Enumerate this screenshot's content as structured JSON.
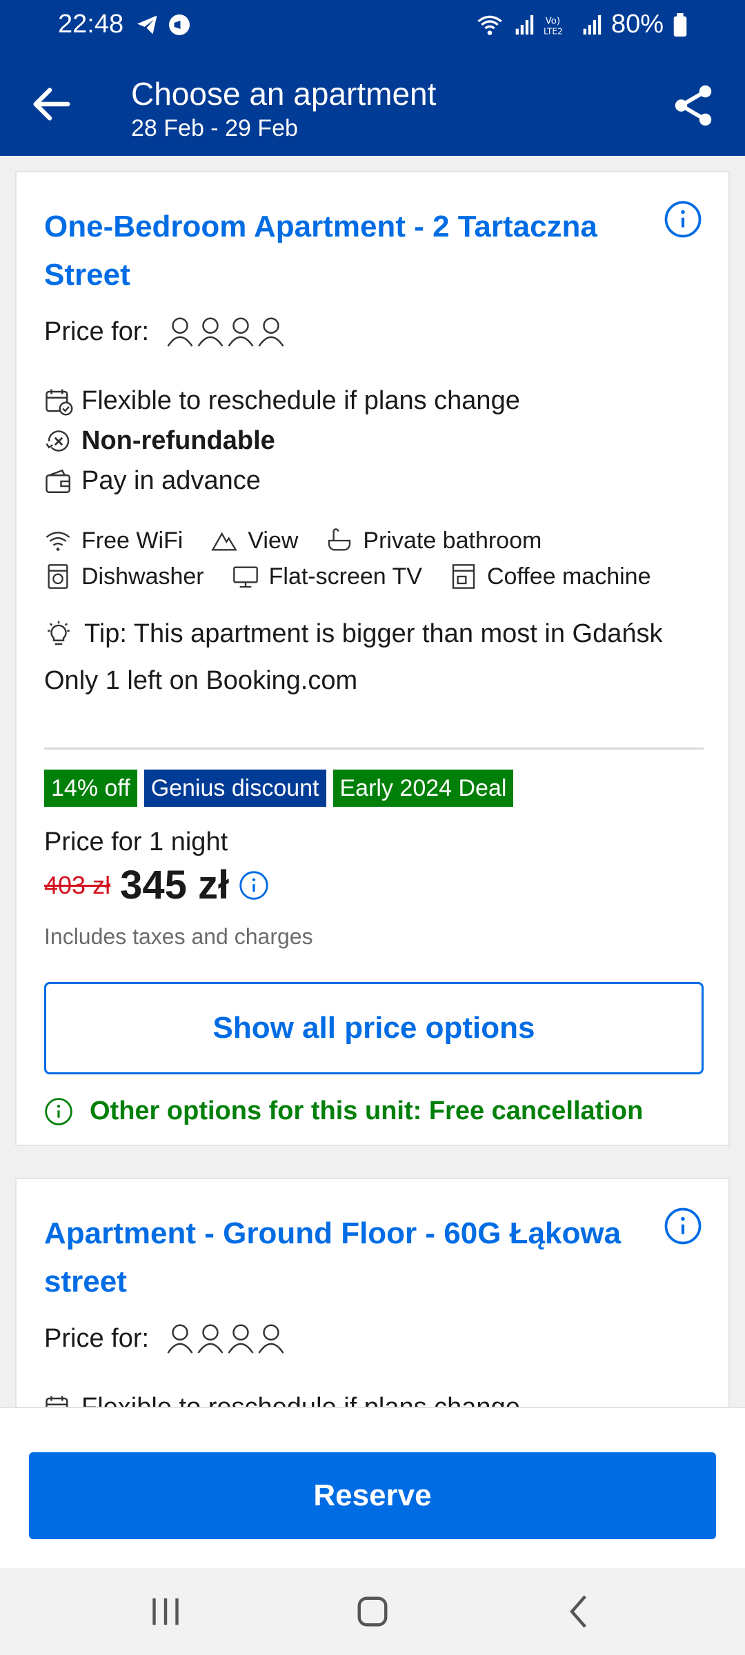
{
  "status_bar": {
    "time": "22:48",
    "battery": "80%",
    "icons": [
      "telegram-icon",
      "app-icon",
      "wifi-icon",
      "signal-icon",
      "volte-icon",
      "battery-icon"
    ]
  },
  "header": {
    "title": "Choose an apartment",
    "dates": "28 Feb - 29 Feb",
    "background_color": "#003b95"
  },
  "cards": [
    {
      "title": "One-Bedroom Apartment - 2 Tartaczna Street",
      "price_for_label": "Price for:",
      "guests": 4,
      "conditions": [
        {
          "icon": "calendar-check-icon",
          "text": "Flexible to reschedule if plans change",
          "bold": false
        },
        {
          "icon": "non-refundable-icon",
          "text": "Non-refundable",
          "bold": true
        },
        {
          "icon": "wallet-icon",
          "text": "Pay in advance",
          "bold": false
        }
      ],
      "facilities_row1": [
        {
          "icon": "wifi-icon",
          "label": "Free WiFi"
        },
        {
          "icon": "mountain-icon",
          "label": "View"
        },
        {
          "icon": "bath-icon",
          "label": "Private bathroom"
        }
      ],
      "facilities_row2": [
        {
          "icon": "dishwasher-icon",
          "label": "Dishwasher"
        },
        {
          "icon": "tv-icon",
          "label": "Flat-screen TV"
        },
        {
          "icon": "coffee-machine-icon",
          "label": "Coffee machine"
        }
      ],
      "tip": "Tip: This apartment is bigger than most in Gdańsk",
      "availability": "Only 1 left on Booking.com",
      "badges": [
        {
          "label": "14% off",
          "color": "#008009"
        },
        {
          "label": "Genius discount",
          "color": "#003b95"
        },
        {
          "label": "Early 2024 Deal",
          "color": "#008009"
        }
      ],
      "price_for_night": "Price for 1 night",
      "old_price": "403 zł",
      "new_price": "345 zł",
      "taxes": "Includes taxes and charges",
      "show_all_button": "Show all price options",
      "other_options": "Other options for this unit: Free cancellation"
    },
    {
      "title": "Apartment - Ground Floor - 60G Łąkowa street",
      "price_for_label": "Price for:",
      "guests": 4,
      "conditions": [
        {
          "icon": "calendar-check-icon",
          "text": "Flexible to reschedule if plans change",
          "bold": false
        }
      ]
    }
  ],
  "reserve_button": "Reserve",
  "colors": {
    "accent": "#006ce4",
    "brand": "#003b95",
    "deal_green": "#008009",
    "strike_red": "#d4111e"
  }
}
